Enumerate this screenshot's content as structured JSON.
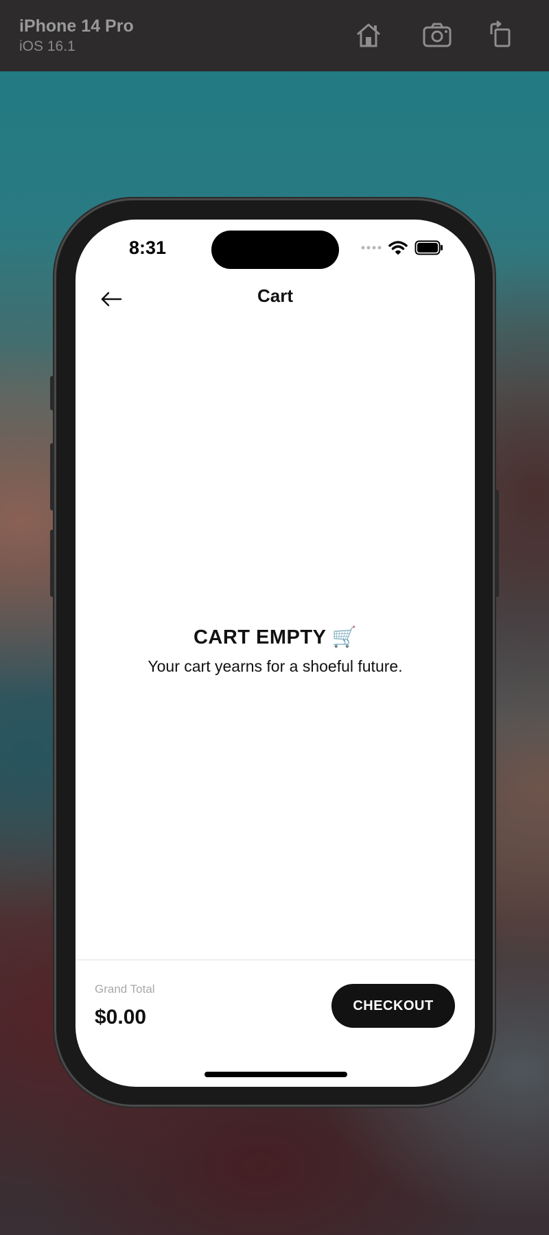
{
  "simulator": {
    "device_name": "iPhone 14 Pro",
    "os_version": "iOS 16.1",
    "buttons": [
      {
        "icon": "home-icon"
      },
      {
        "icon": "screenshot-icon"
      },
      {
        "icon": "rotate-icon"
      }
    ]
  },
  "status_bar": {
    "time": "8:31",
    "icons": [
      "signal-dots-icon",
      "wifi-icon",
      "battery-icon"
    ]
  },
  "nav": {
    "back_icon": "arrow-left-icon",
    "title": "Cart"
  },
  "empty_state": {
    "title": "CART EMPTY",
    "emoji": "🛒",
    "subtitle": "Your cart yearns for a shoeful future."
  },
  "footer": {
    "grand_total_label": "Grand Total",
    "grand_total_value": "$0.00",
    "checkout_label": "CHECKOUT"
  },
  "colors": {
    "sim_bar": "#2d2b2b",
    "button_bg": "#121212",
    "muted_text": "#a8a8a8"
  }
}
